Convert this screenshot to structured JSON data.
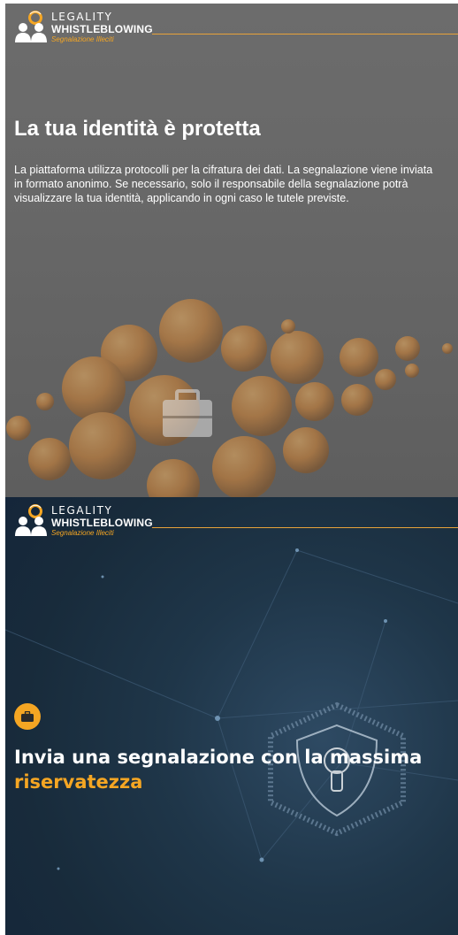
{
  "brand": {
    "name_top": "LEGALITY",
    "name_bottom": "WHISTLEBLOWING",
    "tagline": "Segnalazione Illeciti",
    "colors": {
      "accent": "#f5a623",
      "panel_grey": "#676767",
      "panel_navy": "#1f3649"
    }
  },
  "panel_identity": {
    "title": "La tua identità è protetta",
    "body": "La piattaforma utilizza protocolli per la cifratura dei dati. La segnalazione viene inviata in formato anonimo. Se necessario, solo il responsabile della segnalazione potrà visualizzare la tua identità, applicando in ogni caso le tutele previste.",
    "illustration_icon": "briefcase-icon"
  },
  "panel_confidential": {
    "badge_icon": "briefcase-icon",
    "title_start": "Invia una segnalazione con la massima ",
    "title_highlight": "riservatezza",
    "illustration_icon": "lock-shield-icon"
  }
}
